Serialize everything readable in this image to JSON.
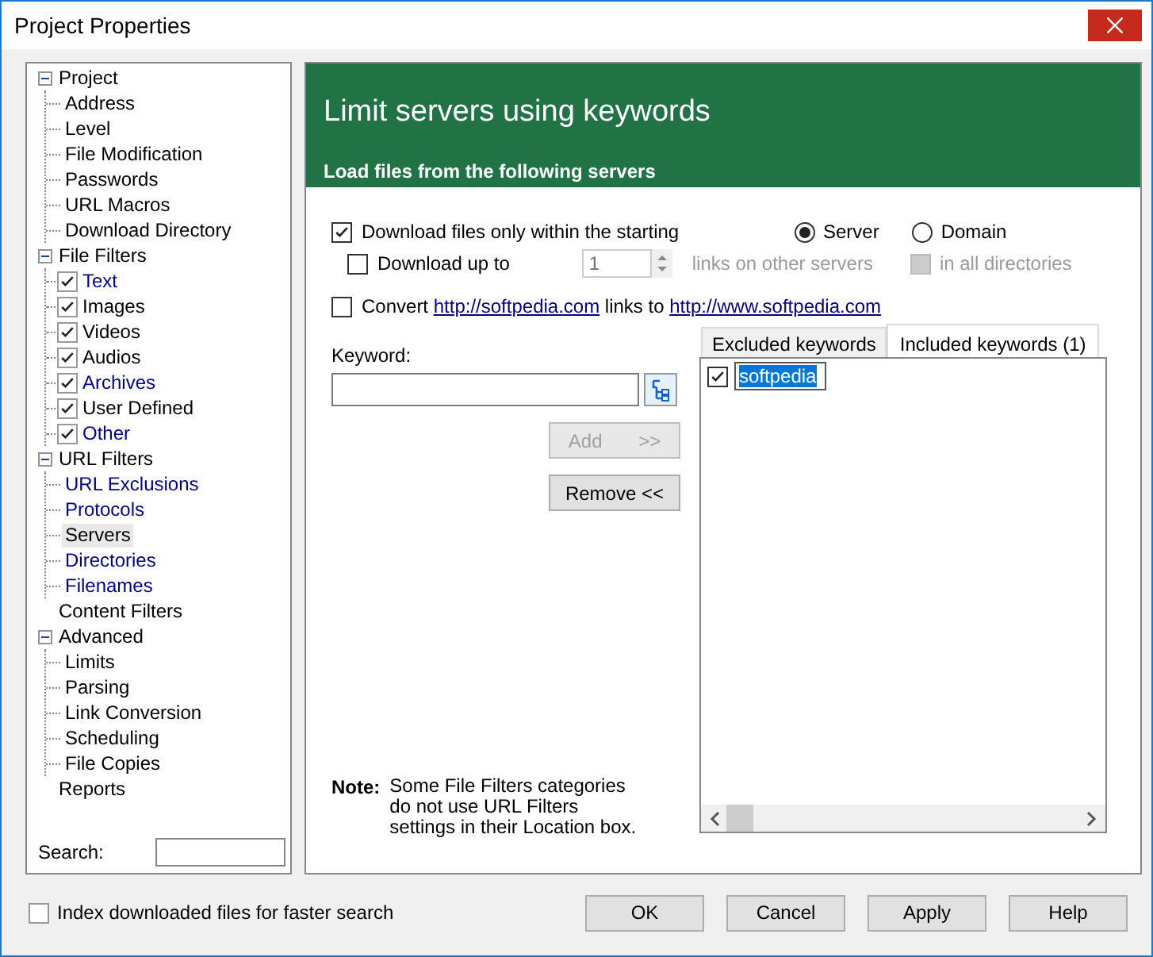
{
  "window": {
    "title": "Project Properties"
  },
  "tree": [
    {
      "label": "Project",
      "expanded": true,
      "selected": false,
      "color": "#000000",
      "children": [
        {
          "label": "Address",
          "selected": false,
          "color": "#000000"
        },
        {
          "label": "Level",
          "selected": false,
          "color": "#000000"
        },
        {
          "label": "File Modification",
          "selected": false,
          "color": "#000000"
        },
        {
          "label": "Passwords",
          "selected": false,
          "color": "#000000"
        },
        {
          "label": "URL Macros",
          "selected": false,
          "color": "#000000"
        },
        {
          "label": "Download Directory",
          "selected": false,
          "color": "#000000"
        }
      ]
    },
    {
      "label": "File Filters",
      "expanded": true,
      "selected": false,
      "color": "#000000",
      "children": [
        {
          "label": "Text",
          "checked": true,
          "selected": false,
          "color": "#000080"
        },
        {
          "label": "Images",
          "checked": true,
          "selected": false,
          "color": "#000000"
        },
        {
          "label": "Videos",
          "checked": true,
          "selected": false,
          "color": "#000000"
        },
        {
          "label": "Audios",
          "checked": true,
          "selected": false,
          "color": "#000000"
        },
        {
          "label": "Archives",
          "checked": true,
          "selected": false,
          "color": "#000080"
        },
        {
          "label": "User Defined",
          "checked": true,
          "selected": false,
          "color": "#000000"
        },
        {
          "label": "Other",
          "checked": true,
          "selected": false,
          "color": "#000080"
        }
      ]
    },
    {
      "label": "URL Filters",
      "expanded": true,
      "selected": false,
      "color": "#000000",
      "children": [
        {
          "label": "URL Exclusions",
          "selected": false,
          "color": "#000080"
        },
        {
          "label": "Protocols",
          "selected": false,
          "color": "#000080"
        },
        {
          "label": "Servers",
          "selected": true,
          "color": "#000000"
        },
        {
          "label": "Directories",
          "selected": false,
          "color": "#000080"
        },
        {
          "label": "Filenames",
          "selected": false,
          "color": "#000080"
        }
      ]
    },
    {
      "label": "Content Filters",
      "selected": false,
      "color": "#000000"
    },
    {
      "label": "Advanced",
      "expanded": true,
      "selected": false,
      "color": "#000000",
      "children": [
        {
          "label": "Limits",
          "selected": false,
          "color": "#000000"
        },
        {
          "label": "Parsing",
          "selected": false,
          "color": "#000000"
        },
        {
          "label": "Link Conversion",
          "selected": false,
          "color": "#000000"
        },
        {
          "label": "Scheduling",
          "selected": false,
          "color": "#000000"
        },
        {
          "label": "File Copies",
          "selected": false,
          "color": "#000000"
        }
      ]
    },
    {
      "label": "Reports",
      "selected": false,
      "color": "#000000"
    }
  ],
  "search": {
    "label": "Search:"
  },
  "header": {
    "title": "Limit servers using keywords",
    "subtitle": "Load files from the following servers"
  },
  "download_within": {
    "label": "Download files only within the starting",
    "checked": true
  },
  "radios": [
    {
      "label": "Server",
      "selected": true
    },
    {
      "label": "Domain",
      "selected": false
    }
  ],
  "download_up_to": {
    "label": "Download up to",
    "checked": false,
    "value": "1",
    "suffix": "links on other servers",
    "disabled": true
  },
  "all_directories": {
    "label": "in all directories",
    "checked": false,
    "disabled": true
  },
  "convert": {
    "checked": false,
    "before": "Convert ",
    "link_1": "http://softpedia.com",
    "middle": " links to ",
    "link_2": "http://www.softpedia.com"
  },
  "keyword": {
    "label": "Keyword:"
  },
  "add_button": {
    "label": "Add",
    "arrows": ">>",
    "disabled": true
  },
  "remove_button": {
    "label": "Remove <<",
    "disabled": false
  },
  "tabs": [
    {
      "label": "Excluded keywords",
      "selected": false
    },
    {
      "label": "Included keywords (1)",
      "selected": true
    }
  ],
  "keywords": [
    {
      "text": "softpedia",
      "checked": true,
      "selected": true
    }
  ],
  "note": {
    "label": "Note:",
    "text": "Some File Filters categories do not use URL Filters settings in their Location box."
  },
  "index_option": {
    "label": "Index downloaded files for faster search",
    "checked": false
  },
  "buttons": [
    "OK",
    "Cancel",
    "Apply",
    "Help"
  ]
}
